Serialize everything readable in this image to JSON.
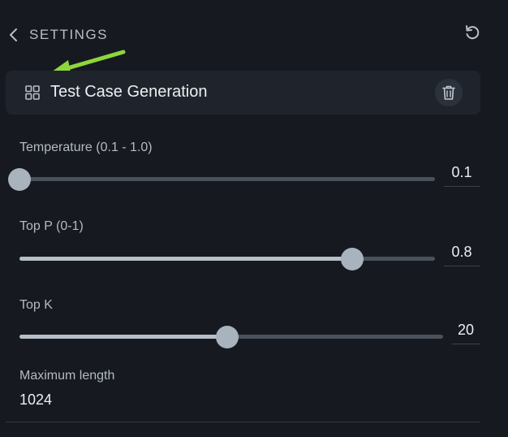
{
  "header": {
    "title": "SETTINGS",
    "back_icon": "chevron-left-icon",
    "reset_icon": "rotate-ccw-icon"
  },
  "card": {
    "name": "Test Case Generation",
    "leading_icon": "grid-icon",
    "action_icon": "trash-icon"
  },
  "sliders": [
    {
      "label": "Temperature (0.1 - 1.0)",
      "value": "0.1",
      "min": 0.1,
      "max": 1.0,
      "level": 0.0
    },
    {
      "label": "Top P (0-1)",
      "value": "0.8",
      "min": 0,
      "max": 1,
      "level": 0.8
    },
    {
      "label": "Top K",
      "value": "20",
      "level": 0.49
    }
  ],
  "max_length": {
    "label": "Maximum length",
    "value": "1024"
  },
  "colors": {
    "background": "#161a20",
    "card": "#1f242c",
    "track": "#4a515b",
    "fill": "#b6bfc8",
    "thumb": "#a8b3bd",
    "annotation_arrow": "#8ed63c"
  }
}
